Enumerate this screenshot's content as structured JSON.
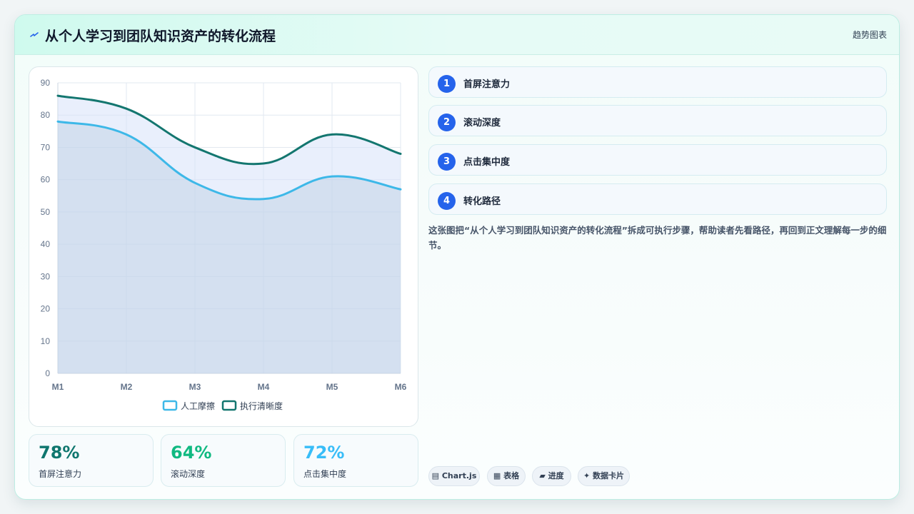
{
  "header": {
    "icon": "sparkle-bolt-icon",
    "title": "从个人学习到团队知识资产的转化流程",
    "tag": "趋势图表"
  },
  "chart_data": {
    "type": "area",
    "categories": [
      "M1",
      "M2",
      "M3",
      "M4",
      "M5",
      "M6"
    ],
    "series": [
      {
        "name": "人工摩擦",
        "values": [
          78,
          74,
          59,
          54,
          61,
          57
        ],
        "color": "#3db8e8"
      },
      {
        "name": "执行清晰度",
        "values": [
          86,
          82,
          70,
          65,
          74,
          68
        ],
        "color": "#13766f"
      }
    ],
    "ylim": [
      0,
      90
    ],
    "yticks": [
      0,
      10,
      20,
      30,
      40,
      50,
      60,
      70,
      80,
      90
    ],
    "grid": true,
    "legend": "bottom"
  },
  "stats": [
    {
      "value": "78%",
      "label": "首屏注意力",
      "color": "#0f766e"
    },
    {
      "value": "64%",
      "label": "滚动深度",
      "color": "#10b981"
    },
    {
      "value": "72%",
      "label": "点击集中度",
      "color": "#38bdf8"
    }
  ],
  "steps": [
    {
      "num": "1",
      "label": "首屏注意力"
    },
    {
      "num": "2",
      "label": "滚动深度"
    },
    {
      "num": "3",
      "label": "点击集中度"
    },
    {
      "num": "4",
      "label": "转化路径"
    }
  ],
  "description": "这张图把“从个人学习到团队知识资产的转化流程”拆成可执行步骤，帮助读者先看路径，再回到正文理解每一步的细节。",
  "chips": [
    {
      "icon": "chart-icon",
      "label": "Chart.js"
    },
    {
      "icon": "table-icon",
      "label": "表格"
    },
    {
      "icon": "progress-icon",
      "label": "进度"
    },
    {
      "icon": "sparkle-icon",
      "label": "数据卡片"
    }
  ]
}
